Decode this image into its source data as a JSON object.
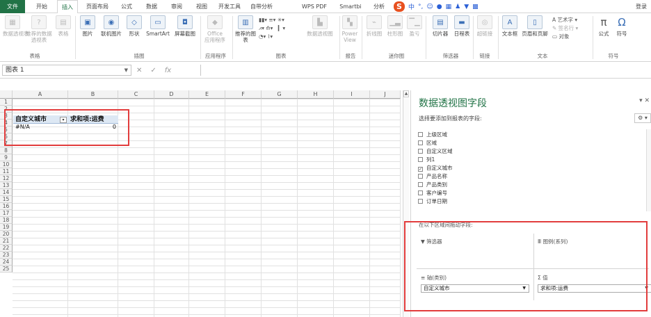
{
  "tabs": {
    "file": "文件",
    "home": "开始",
    "insert": "插入",
    "layout": "页面布局",
    "formulas": "公式",
    "data": "数据",
    "review": "审阅",
    "view": "视图",
    "devtools": "开发工具",
    "selfanalysis": "自带分析",
    "wpspdf": "WPS PDF",
    "smartbi": "Smartbi",
    "analyze": "分析",
    "login": "登录"
  },
  "ribbon": {
    "pivot_table": "数据透视表",
    "recommended_pivot": "推荐的数据透视表",
    "table": "表格",
    "picture": "图片",
    "online_picture": "联机图片",
    "shapes": "形状",
    "smartart": "SmartArt",
    "screenshot": "屏幕截图",
    "office": "Office",
    "apps": "应用程序",
    "recommended_charts": "推荐的图表",
    "pivot_chart": "数据透视图",
    "power": "Power",
    "view": "View",
    "line": "折线图",
    "column": "柱形图",
    "winloss": "盈亏",
    "slicer": "切片器",
    "timeline": "日程表",
    "hyperlink": "超链接",
    "textbox": "文本框",
    "header_footer": "页眉和页脚",
    "wordart": "艺术字",
    "signature": "签名行",
    "object": "对象",
    "equation": "公式",
    "symbol": "符号",
    "group_tables": "表格",
    "group_illustrations": "插图",
    "group_apps": "应用程序",
    "group_charts": "图表",
    "group_reports": "报告",
    "group_sparklines": "迷你图",
    "group_filters": "筛选器",
    "group_links": "链接",
    "group_text": "文本",
    "group_symbols": "符号"
  },
  "formula_bar": {
    "name_box": "图表 1",
    "cancel": "✕",
    "enter": "✓",
    "fx": "fx"
  },
  "grid": {
    "columns": [
      "A",
      "B",
      "C",
      "D",
      "E",
      "F",
      "G",
      "H",
      "I",
      "J"
    ],
    "rows": [
      "1",
      "2",
      "3",
      "4",
      "5",
      "6",
      "7",
      "8",
      "9",
      "10",
      "11",
      "12",
      "13",
      "14",
      "15",
      "16",
      "17",
      "18",
      "19",
      "20",
      "21",
      "22",
      "23",
      "24",
      "25"
    ],
    "pivot_row_label": "自定义城市",
    "pivot_value_label": "求和项:运费",
    "pivot_row_value": "#N/A",
    "pivot_value": "0"
  },
  "pane": {
    "title": "数据透视图字段",
    "subtitle": "选择要添加到报表的字段:",
    "fields": [
      {
        "label": "上级区域",
        "checked": false
      },
      {
        "label": "区域",
        "checked": false
      },
      {
        "label": "自定义区域",
        "checked": false
      },
      {
        "label": "列1",
        "checked": false
      },
      {
        "label": "自定义城市",
        "checked": true
      },
      {
        "label": "产品名称",
        "checked": false
      },
      {
        "label": "产品类别",
        "checked": false
      },
      {
        "label": "客户编号",
        "checked": false
      },
      {
        "label": "订单日期",
        "checked": false
      }
    ],
    "drag_label": "在以下区域间拖动字段:",
    "filters": "筛选器",
    "legend": "图例(系列)",
    "axis": "轴(类别)",
    "values": "值",
    "axis_field": "自定义城市",
    "values_field": "求和项:运费"
  }
}
